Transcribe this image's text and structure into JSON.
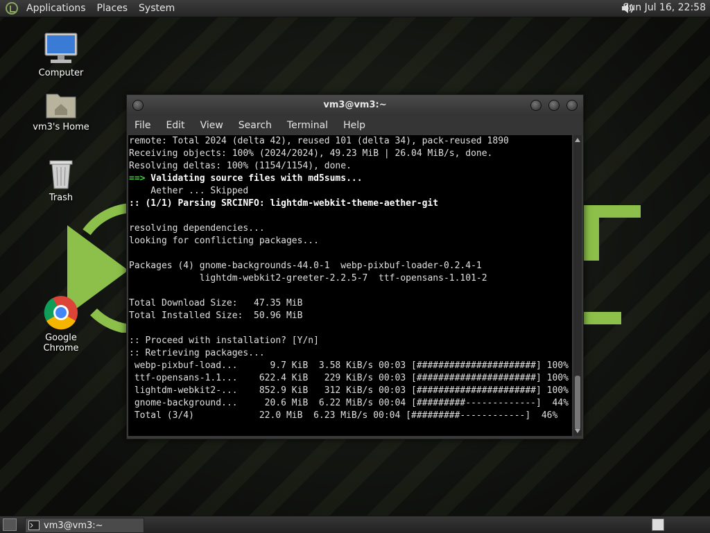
{
  "top_panel": {
    "menus": [
      "Applications",
      "Places",
      "System"
    ],
    "clock": "Sun Jul 16, 22:58"
  },
  "desktop_icons": [
    {
      "label": "Computer",
      "icon": "computer-icon"
    },
    {
      "label": "vm3's Home",
      "icon": "home-folder-icon"
    },
    {
      "label": "Trash",
      "icon": "trash-icon"
    },
    {
      "label": "Google Chrome",
      "icon": "chrome-icon"
    }
  ],
  "terminal": {
    "title": "vm3@vm3:~",
    "menu": [
      "File",
      "Edit",
      "View",
      "Search",
      "Terminal",
      "Help"
    ],
    "lines": [
      {
        "style": "n",
        "text": "remote: Total 2024 (delta 42), reused 101 (delta 34), pack-reused 1890"
      },
      {
        "style": "n",
        "text": "Receiving objects: 100% (2024/2024), 49.23 MiB | 26.04 MiB/s, done."
      },
      {
        "style": "n",
        "text": "Resolving deltas: 100% (1154/1154), done."
      },
      {
        "style": "arrow",
        "prefix": "==>",
        "text": " Validating source files with md5sums..."
      },
      {
        "style": "n",
        "text": "    Aether ... Skipped"
      },
      {
        "style": "b",
        "text": ":: (1/1) Parsing SRCINFO: lightdm-webkit-theme-aether-git"
      },
      {
        "style": "n",
        "text": ""
      },
      {
        "style": "n",
        "text": "resolving dependencies..."
      },
      {
        "style": "n",
        "text": "looking for conflicting packages..."
      },
      {
        "style": "n",
        "text": ""
      },
      {
        "style": "n",
        "text": "Packages (4) gnome-backgrounds-44.0-1  webp-pixbuf-loader-0.2.4-1"
      },
      {
        "style": "n",
        "text": "             lightdm-webkit2-greeter-2.2.5-7  ttf-opensans-1.101-2"
      },
      {
        "style": "n",
        "text": ""
      },
      {
        "style": "n",
        "text": "Total Download Size:   47.35 MiB"
      },
      {
        "style": "n",
        "text": "Total Installed Size:  50.96 MiB"
      },
      {
        "style": "n",
        "text": ""
      },
      {
        "style": "n",
        "text": ":: Proceed with installation? [Y/n]"
      },
      {
        "style": "n",
        "text": ":: Retrieving packages..."
      },
      {
        "style": "n",
        "text": " webp-pixbuf-load...      9.7 KiB  3.58 KiB/s 00:03 [######################] 100%"
      },
      {
        "style": "n",
        "text": " ttf-opensans-1.1...    622.4 KiB   229 KiB/s 00:03 [######################] 100%"
      },
      {
        "style": "n",
        "text": " lightdm-webkit2-...    852.9 KiB   312 KiB/s 00:03 [######################] 100%"
      },
      {
        "style": "n",
        "text": " gnome-background...     20.6 MiB  6.22 MiB/s 00:04 [#########-------------]  44%"
      },
      {
        "style": "n",
        "text": " Total (3/4)            22.0 MiB  6.23 MiB/s 00:04 [#########------------]  46%"
      }
    ]
  },
  "taskbar": {
    "items": [
      {
        "label": "vm3@vm3:~",
        "icon": "terminal-icon"
      }
    ]
  },
  "colors": {
    "accent_green": "#8cc04a",
    "prompt_green": "#3bd23b"
  }
}
